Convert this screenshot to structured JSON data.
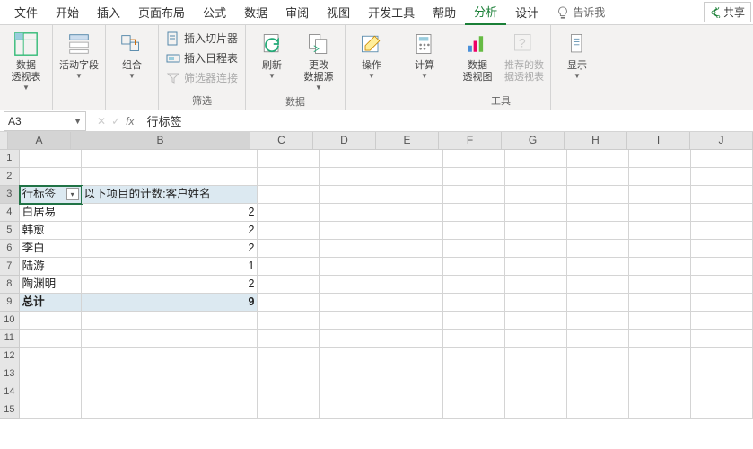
{
  "tabs": {
    "file": "文件",
    "home": "开始",
    "insert": "插入",
    "pagelayout": "页面布局",
    "formulas": "公式",
    "data": "数据",
    "review": "审阅",
    "view": "视图",
    "developer": "开发工具",
    "help": "帮助",
    "analyze": "分析",
    "design": "设计",
    "tellme": "告诉我",
    "share": "共享"
  },
  "ribbon": {
    "pivottable": "数据\n透视表",
    "activefield": "活动字段",
    "group": "组合",
    "filter": {
      "slicer": "插入切片器",
      "timeline": "插入日程表",
      "filterconn": "筛选器连接",
      "label": "筛选"
    },
    "refresh": "刷新",
    "changesrc": "更改\n数据源",
    "datalabel": "数据",
    "actions": "操作",
    "calc": "计算",
    "chart": "数据\n透视图",
    "recommend": "推荐的数\n据透视表",
    "show": "显示",
    "tools": "工具"
  },
  "formula": {
    "namebox": "A3",
    "value": "行标签"
  },
  "cols": [
    "A",
    "B",
    "C",
    "D",
    "E",
    "F",
    "G",
    "H",
    "I",
    "J"
  ],
  "pivot": {
    "header_row_label": "行标签",
    "header_count": "以下项目的计数:客户姓名",
    "rows": [
      {
        "label": "白居易",
        "value": "2"
      },
      {
        "label": "韩愈",
        "value": "2"
      },
      {
        "label": "李白",
        "value": "2"
      },
      {
        "label": "陆游",
        "value": "1"
      },
      {
        "label": "陶渊明",
        "value": "2"
      }
    ],
    "total_label": "总计",
    "total_value": "9"
  },
  "chart_data": {
    "type": "table",
    "title": "以下项目的计数:客户姓名",
    "categories": [
      "白居易",
      "韩愈",
      "李白",
      "陆游",
      "陶渊明"
    ],
    "values": [
      2,
      2,
      2,
      1,
      2
    ],
    "total": 9
  },
  "widths": {
    "A": 70,
    "B": 200,
    "other": 70
  }
}
